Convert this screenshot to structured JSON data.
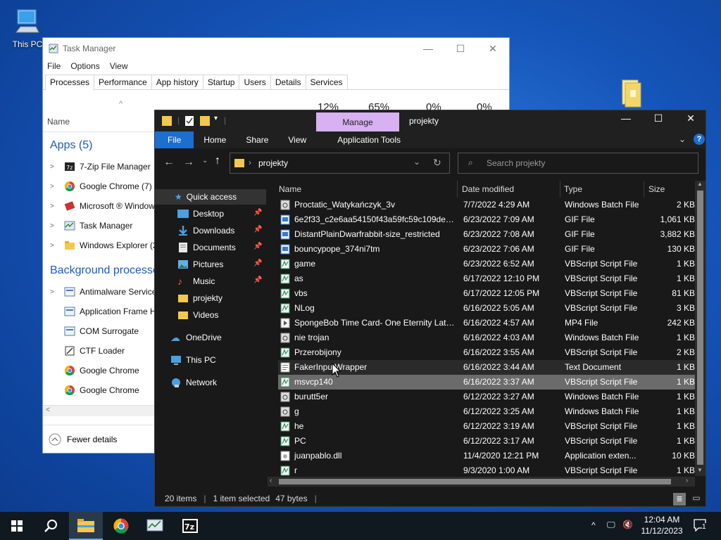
{
  "desktop": {
    "this_pc_label": "This PC"
  },
  "taskmgr": {
    "title": "Task Manager",
    "menu": [
      "File",
      "Options",
      "View"
    ],
    "tabs": [
      "Processes",
      "Performance",
      "App history",
      "Startup",
      "Users",
      "Details",
      "Services"
    ],
    "stats": {
      "cpu": "12%",
      "memory": "65%",
      "disk": "0%",
      "network": "0%"
    },
    "col_name": "Name",
    "apps_group": "Apps (5)",
    "apps": [
      "7-Zip File Manager",
      "Google Chrome (7)",
      "Microsoft ® Windows",
      "Task Manager",
      "Windows Explorer (2)"
    ],
    "bg_group": "Background processes",
    "bg": [
      "Antimalware Service",
      "Application Frame H",
      "COM Surrogate",
      "CTF Loader",
      "Google Chrome",
      "Google Chrome"
    ],
    "fewer_details": "Fewer details"
  },
  "explorer": {
    "title": "projekty",
    "manage": "Manage",
    "ribbon": {
      "file": "File",
      "home": "Home",
      "share": "Share",
      "view": "View",
      "app_tools": "Application Tools"
    },
    "address": "projekty",
    "search_placeholder": "Search projekty",
    "nav": {
      "quick_access": "Quick access",
      "desktop": "Desktop",
      "downloads": "Downloads",
      "documents": "Documents",
      "pictures": "Pictures",
      "music": "Music",
      "projekty": "projekty",
      "videos": "Videos",
      "onedrive": "OneDrive",
      "this_pc": "This PC",
      "network": "Network"
    },
    "columns": {
      "name": "Name",
      "date": "Date modified",
      "type": "Type",
      "size": "Size"
    },
    "files": [
      {
        "name": "Proctatic_Watykańczyk_3v",
        "date": "7/7/2022 4:29 AM",
        "type": "Windows Batch File",
        "size": "2 KB",
        "icon": "batch-file-icon"
      },
      {
        "name": "6e2f33_c2e6aa54150f43a59fc59c109de7a4...",
        "date": "6/23/2022 7:09 AM",
        "type": "GIF File",
        "size": "1,061 KB",
        "icon": "gif-file-icon"
      },
      {
        "name": "DistantPlainDwarfrabbit-size_restricted",
        "date": "6/23/2022 7:08 AM",
        "type": "GIF File",
        "size": "3,882 KB",
        "icon": "gif-file-icon"
      },
      {
        "name": "bouncypope_374ni7tm",
        "date": "6/23/2022 7:06 AM",
        "type": "GIF File",
        "size": "130 KB",
        "icon": "gif-file-icon"
      },
      {
        "name": "game",
        "date": "6/23/2022 6:52 AM",
        "type": "VBScript Script File",
        "size": "1 KB",
        "icon": "vbs-file-icon"
      },
      {
        "name": "as",
        "date": "6/17/2022 12:10 PM",
        "type": "VBScript Script File",
        "size": "1 KB",
        "icon": "vbs-file-icon"
      },
      {
        "name": "vbs",
        "date": "6/17/2022 12:05 PM",
        "type": "VBScript Script File",
        "size": "81 KB",
        "icon": "vbs-file-icon"
      },
      {
        "name": "NLog",
        "date": "6/16/2022 5:05 AM",
        "type": "VBScript Script File",
        "size": "3 KB",
        "icon": "vbs-file-icon"
      },
      {
        "name": "SpongeBob Time Card- One Eternity Late...",
        "date": "6/16/2022 4:57 AM",
        "type": "MP4 File",
        "size": "242 KB",
        "icon": "video-file-icon"
      },
      {
        "name": "nie trojan",
        "date": "6/16/2022 4:03 AM",
        "type": "Windows Batch File",
        "size": "1 KB",
        "icon": "batch-file-icon"
      },
      {
        "name": "Przerobijony",
        "date": "6/16/2022 3:55 AM",
        "type": "VBScript Script File",
        "size": "2 KB",
        "icon": "vbs-file-icon"
      },
      {
        "name": "FakerInputWrapper",
        "date": "6/16/2022 3:44 AM",
        "type": "Text Document",
        "size": "1 KB",
        "icon": "text-file-icon"
      },
      {
        "name": "msvcp140",
        "date": "6/16/2022 3:37 AM",
        "type": "VBScript Script File",
        "size": "1 KB",
        "icon": "vbs-file-icon"
      },
      {
        "name": "burutt5er",
        "date": "6/12/2022 3:27 AM",
        "type": "Windows Batch File",
        "size": "1 KB",
        "icon": "batch-file-icon"
      },
      {
        "name": "g",
        "date": "6/12/2022 3:25 AM",
        "type": "Windows Batch File",
        "size": "1 KB",
        "icon": "batch-file-icon"
      },
      {
        "name": "he",
        "date": "6/12/2022 3:19 AM",
        "type": "VBScript Script File",
        "size": "1 KB",
        "icon": "vbs-file-icon"
      },
      {
        "name": "PC",
        "date": "6/12/2022 3:17 AM",
        "type": "VBScript Script File",
        "size": "1 KB",
        "icon": "vbs-file-icon"
      },
      {
        "name": "juanpablo.dll",
        "date": "11/4/2020 12:21 PM",
        "type": "Application exten...",
        "size": "10 KB",
        "icon": "dll-file-icon"
      },
      {
        "name": "r",
        "date": "9/3/2020 1:00 AM",
        "type": "VBScript Script File",
        "size": "1 KB",
        "icon": "vbs-file-icon"
      }
    ],
    "status": {
      "count": "20 items",
      "selected": "1 item selected",
      "size": "47 bytes"
    }
  },
  "taskbar": {
    "time": "12:04 AM",
    "date": "11/12/2023",
    "notifications": "1"
  }
}
